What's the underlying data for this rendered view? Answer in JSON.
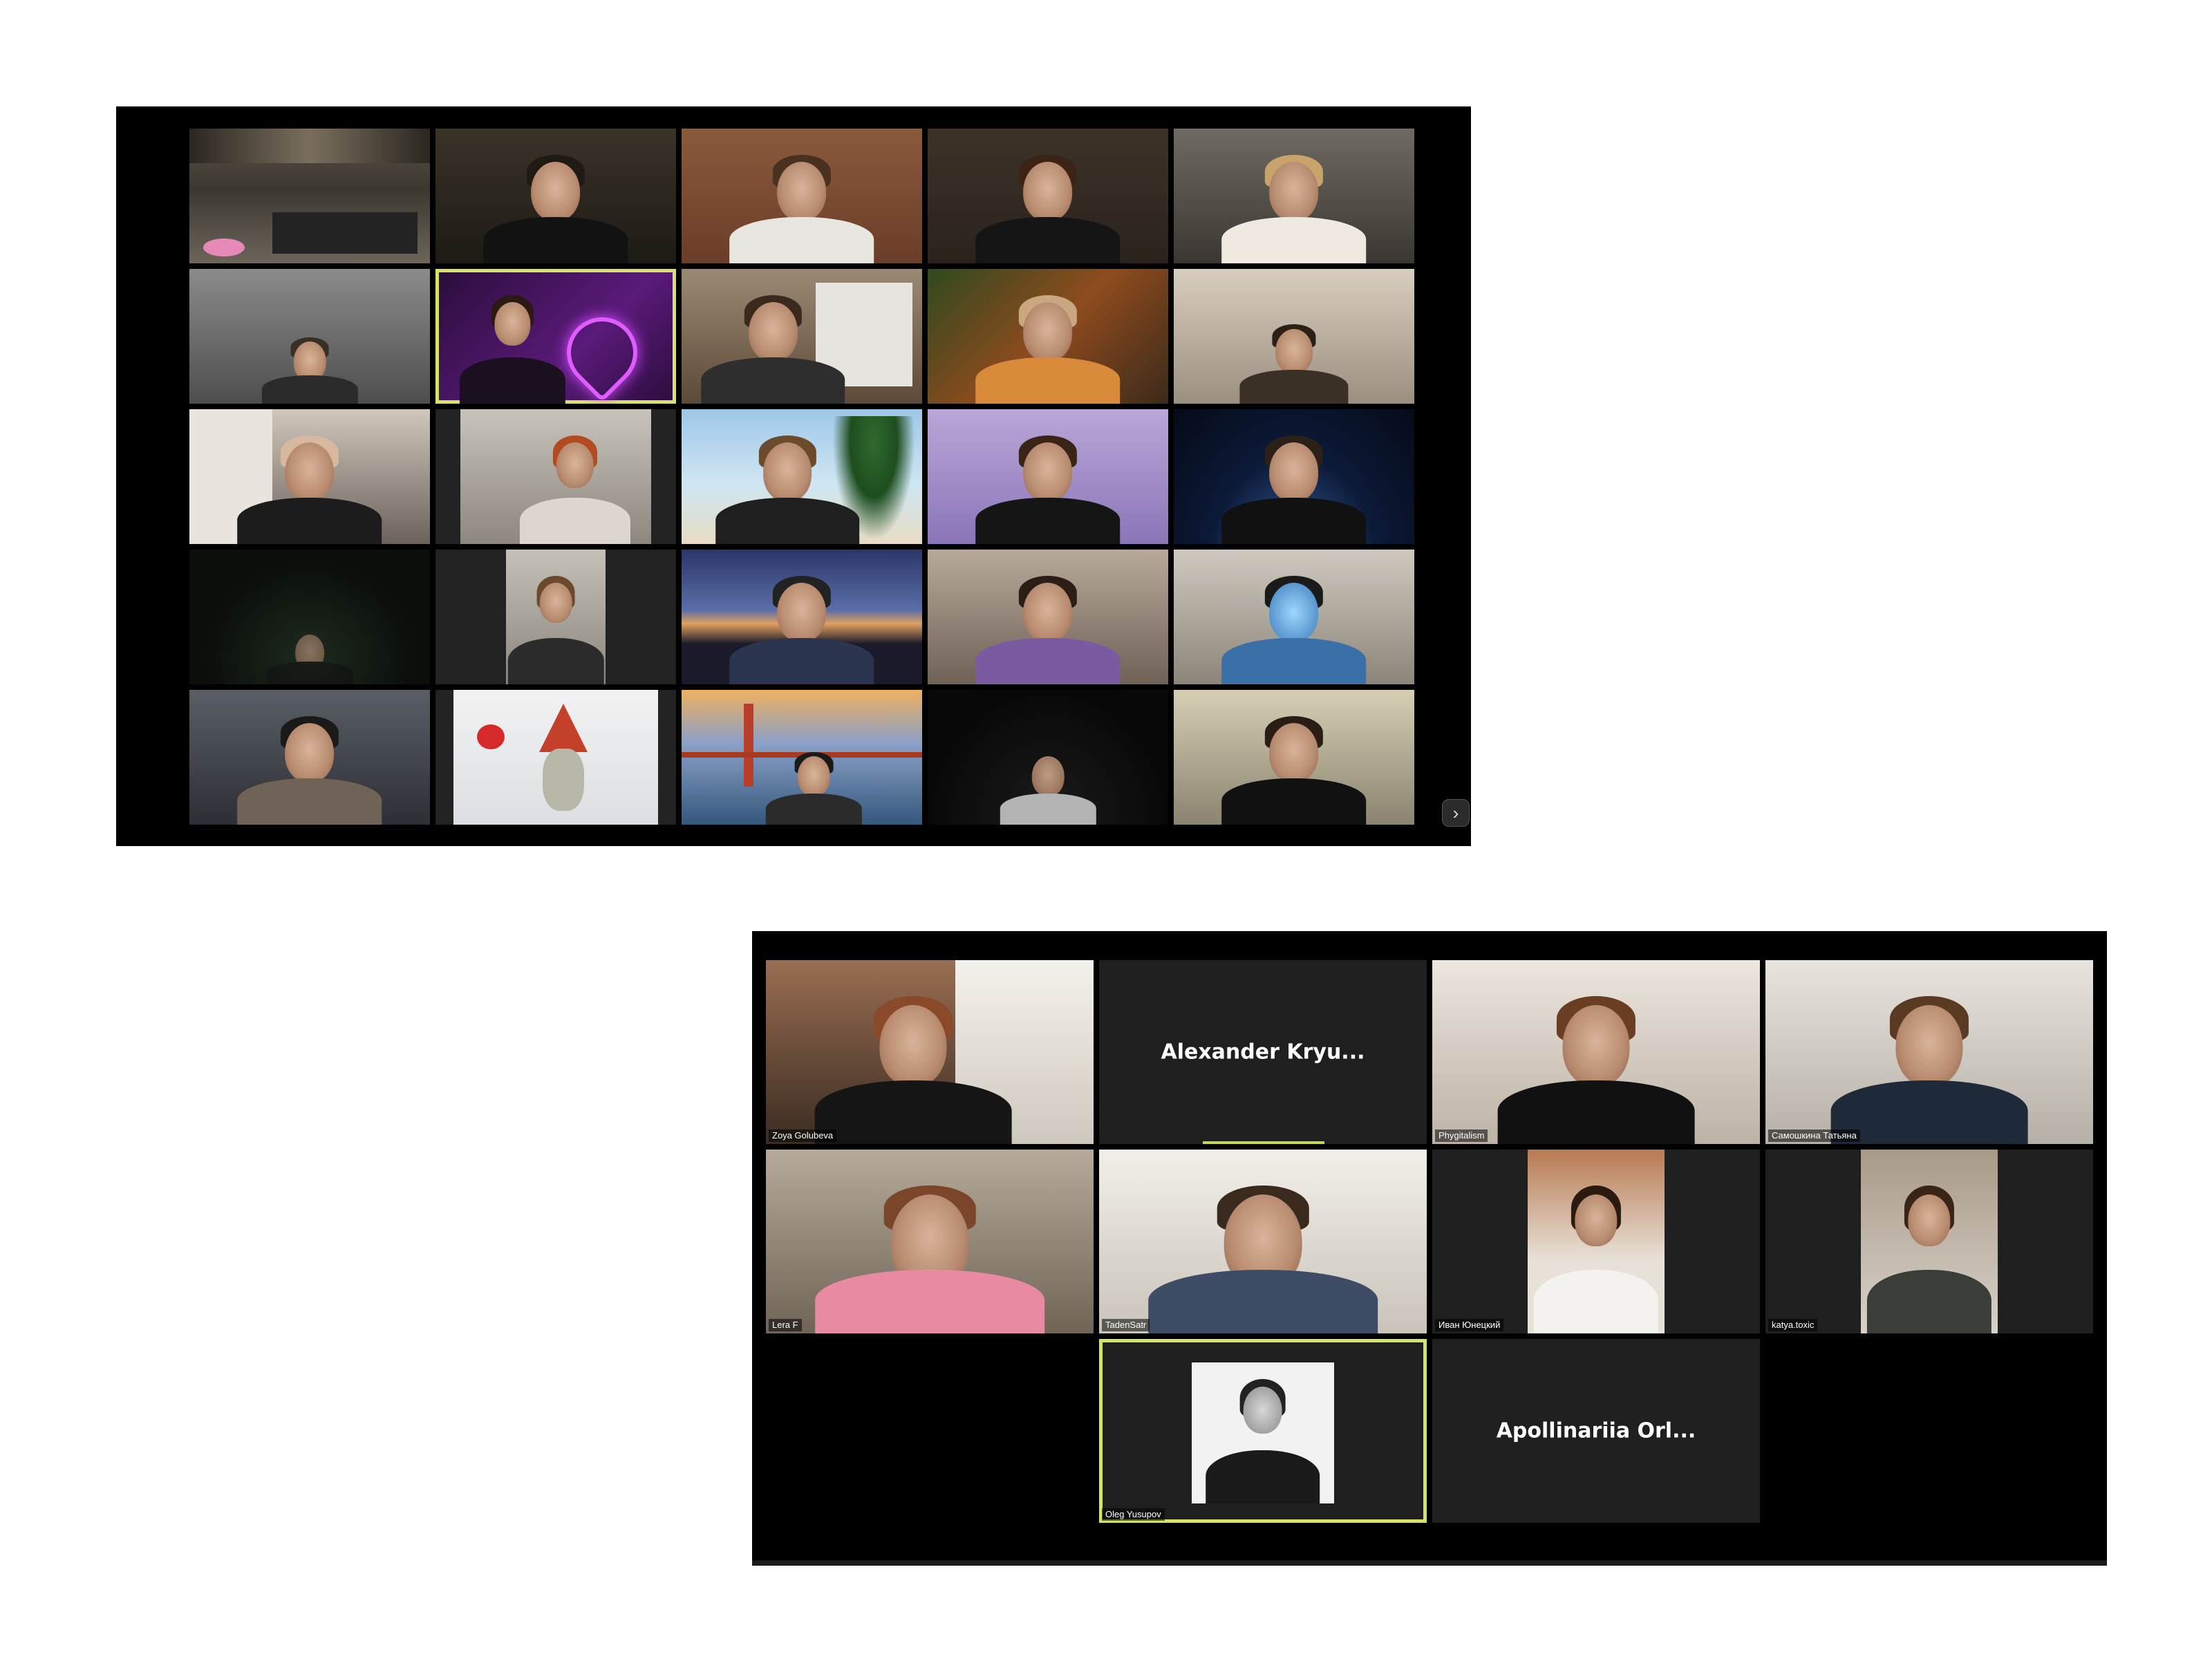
{
  "window_top": {
    "next_page_glyph": "›"
  },
  "window_bottom": {
    "tiles": [
      {
        "name": "Zoya Golubeva"
      },
      {
        "name": "Alexander  Kryu..."
      },
      {
        "name": "Phygitalism"
      },
      {
        "name": "Самошкина Татьяна"
      },
      {
        "name": "Lera F"
      },
      {
        "name": "TadenSatr"
      },
      {
        "name": "Иван Юнецкий"
      },
      {
        "name": "katya.toxic"
      },
      {
        "name": "Oleg Yusupov"
      },
      {
        "name": "Apollinariia Orl..."
      }
    ]
  },
  "colors": {
    "active_speaker_border": "#d6e36a",
    "meeting_background": "#000000",
    "empty_tile": "#1f1f1f"
  }
}
